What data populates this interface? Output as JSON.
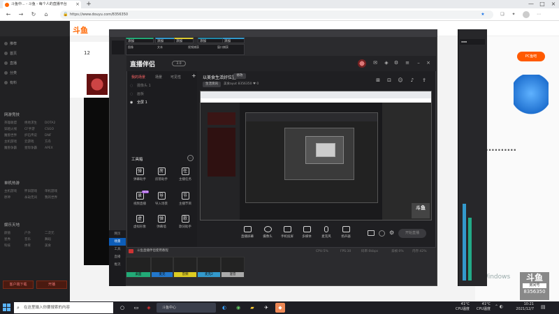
{
  "browser": {
    "tab_title": "斗鱼中... - 斗鱼 - 每个人的直播平台",
    "tab_close": "×",
    "new_tab": "+",
    "url": "https://www.douyu.com/8356350",
    "window_min": "—",
    "window_max": "□",
    "window_close": "×"
  },
  "page": {
    "site_logo": "斗鱼",
    "anchor_follow_count": "12",
    "promo_badge": "PC鱼吧",
    "side_nav": [
      "推荐",
      "首页",
      "直播",
      "分类",
      "有料"
    ],
    "sections": [
      {
        "title": "网游竞技",
        "items": [
          "英雄联盟",
          "绝地求生",
          "DOTA2",
          "穿越火线",
          "CF手游",
          "CSGO",
          "魔兽世界",
          "炉石传说",
          "DNF",
          "主机游戏",
          "云游戏",
          "方舟",
          "魔兽争霸",
          "星际争霸",
          "APEX"
        ]
      },
      {
        "title": "单机热游",
        "items": [
          "主机游戏",
          "怀旧游戏",
          "单机游戏",
          "原神",
          "永劫无间",
          "我的世界"
        ]
      },
      {
        "title": "娱乐天地",
        "items": [
          "颜值",
          "户外",
          "二次元",
          "星秀",
          "音乐",
          "舞蹈",
          "科技",
          "体育",
          "美食"
        ]
      }
    ],
    "bottom_buttons": [
      "客户端下载",
      "开播"
    ],
    "watermark": "Windows",
    "douyu_badge": {
      "logo": "斗鱼",
      "label": "房间号",
      "room_id": "8356350"
    }
  },
  "obs": {
    "tabs": [
      "添加",
      "添加",
      "添加",
      "添加",
      "添加"
    ],
    "sub_rows": [
      "图像",
      "文本",
      "视频捕获",
      "窗口捕获"
    ],
    "mixers": [
      "桌面",
      "麦克",
      "音频",
      "麦克2",
      "混音"
    ]
  },
  "companion": {
    "logo": "直播伴侣",
    "version_badge": "3.0",
    "scene_tabs": [
      "我的场景",
      "场景",
      "可见性"
    ],
    "add_scene": "+",
    "scenes": [
      "摄像头 1",
      "画板",
      "全屏 1"
    ],
    "tools_title": "工具箱",
    "tools": [
      {
        "icon": "弹",
        "label": "弹幕助手"
      },
      {
        "icon": "房",
        "label": "房管助手"
      },
      {
        "icon": "任",
        "label": "主播任务"
      },
      {
        "icon": "录",
        "label": "视频直播",
        "tag": "NEW"
      },
      {
        "icon": "导",
        "label": "导入场景"
      },
      {
        "icon": "节",
        "label": "主播节目"
      },
      {
        "icon": "虚",
        "label": "虚拟形象"
      },
      {
        "icon": "弹",
        "label": "弹幕墙"
      },
      {
        "icon": "歌",
        "label": "歌词助手"
      },
      {
        "icon": "图",
        "label": "图像美化"
      },
      {
        "icon": "游",
        "label": "游戏直播"
      },
      {
        "icon": "工",
        "label": "工具"
      }
    ],
    "room_title": "以美食生活好位置",
    "room_edit": "修改",
    "room_tag": "生活资讯",
    "room_meta": "美食ayut  8356350  ♥ 0",
    "bottom_tools": [
      "直播屏幕",
      "摄像头",
      "手机投屏",
      "多媒体",
      "麦克风",
      "扬声器"
    ],
    "go_live": "开始直播",
    "notice": "斗鱼直播伴侣使用教程",
    "status_items": [
      "CPU:5%",
      "FPS:30",
      "码率:0kbps",
      "丢帧:0%",
      "内存:42%"
    ],
    "side_items": [
      "网页",
      "场景",
      "工具",
      "直播",
      "推流"
    ]
  },
  "taskbar": {
    "search_placeholder": "在这里输入你要搜索的内容",
    "edge_label": "斗鱼中心",
    "temp1": "41°C",
    "temp1_label": "CPU温度",
    "temp2": "41°C",
    "temp2_label": "CPU温度",
    "time": "10:21",
    "date": "2021/12/7"
  },
  "colors": {
    "accent_orange": "#ff5a00",
    "companion_blue": "#0d5db8"
  }
}
